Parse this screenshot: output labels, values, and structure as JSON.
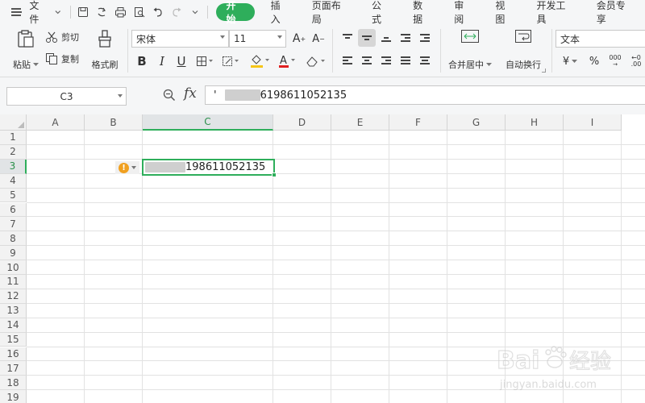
{
  "menubar": {
    "file_label": "文件",
    "tabs": [
      "开始",
      "插入",
      "页面布局",
      "公式",
      "数据",
      "审阅",
      "视图",
      "开发工具",
      "会员专享"
    ],
    "active_tab": "开始"
  },
  "ribbon": {
    "paste_label": "粘贴",
    "cut_label": "剪切",
    "copy_label": "复制",
    "format_painter_label": "格式刷",
    "font_name": "宋体",
    "font_size": "11",
    "bold": "B",
    "italic": "I",
    "underline": "U",
    "merge_label": "合并居中",
    "wrap_label": "自动换行",
    "number_format": "文本",
    "currency_symbol": "¥",
    "percent_symbol": "%",
    "thousands_symbol": "000"
  },
  "formula_bar": {
    "cell_ref": "C3",
    "fx": "fx",
    "content_prefix": "'",
    "content_visible": "6198611052135"
  },
  "sheet": {
    "columns": [
      "A",
      "B",
      "C",
      "D",
      "E",
      "F",
      "G",
      "H",
      "I"
    ],
    "rows": [
      "1",
      "2",
      "3",
      "4",
      "5",
      "6",
      "7",
      "8",
      "9",
      "10",
      "11",
      "12",
      "13",
      "14",
      "15",
      "16",
      "17",
      "18",
      "19"
    ],
    "selected_col": "C",
    "selected_row": "3",
    "active_cell_visible": "198611052135",
    "warning_symbol": "!"
  },
  "watermark": {
    "brand": "Bai",
    "brand_cn": "经验",
    "url": "jingyan.baidu.com"
  }
}
